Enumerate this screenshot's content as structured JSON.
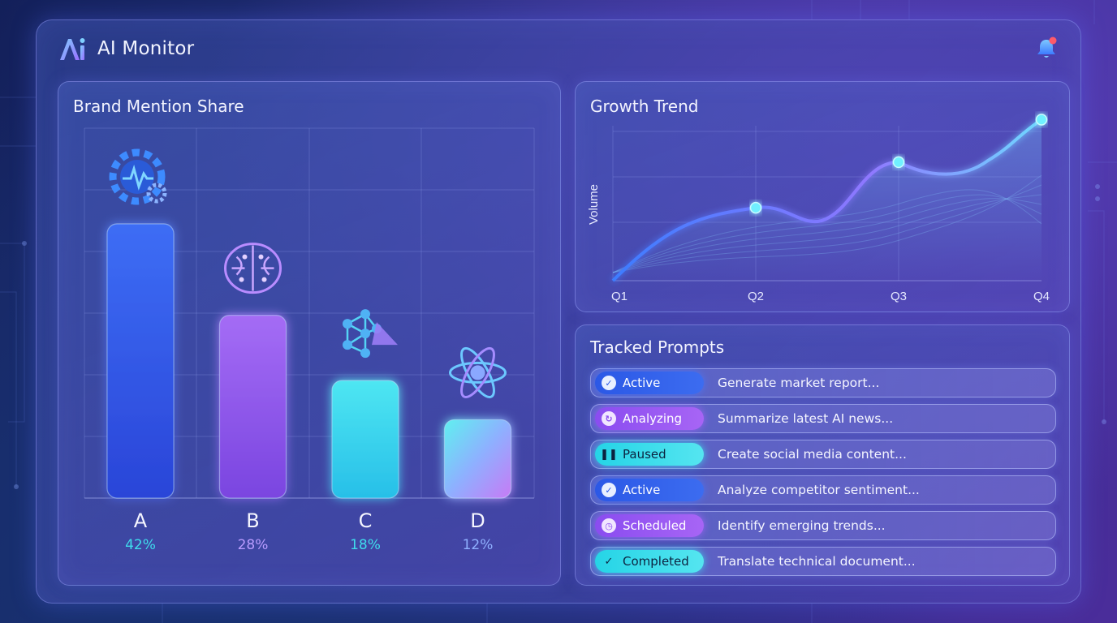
{
  "app": {
    "title": "AI Monitor",
    "logo_icon": "ai-logo-icon",
    "notification_icon": "bell-icon"
  },
  "colors": {
    "blue": "#3b6cf5",
    "purple": "#9a5cf2",
    "cyan": "#3fdcec",
    "gradient": "#8fb0ff",
    "accent_dot": "#ff5a6a"
  },
  "brand_share": {
    "title": "Brand Mention Share",
    "chart_data": {
      "type": "bar",
      "title": "Brand Mention Share",
      "categories": [
        "A",
        "B",
        "C",
        "D"
      ],
      "values": [
        42,
        28,
        18,
        12
      ],
      "value_labels": [
        "42%",
        "28%",
        "18%",
        "12%"
      ],
      "icons": [
        "gear-pulse-icon",
        "brain-circuit-icon",
        "network-prism-icon",
        "atom-icon"
      ],
      "ylim": [
        0,
        50
      ],
      "grid": true
    }
  },
  "growth": {
    "title": "Growth Trend",
    "chart_data": {
      "type": "line",
      "title": "Growth Trend",
      "categories": [
        "Q1",
        "Q2",
        "Q3",
        "Q4"
      ],
      "ylabel": "Volume",
      "values": [
        0,
        48,
        78,
        106
      ],
      "ylim": [
        0,
        110
      ],
      "grid": true
    }
  },
  "prompts": {
    "title": "Tracked Prompts",
    "items": [
      {
        "status": "Active",
        "style": "active",
        "icon": "check-circle-icon",
        "text": "Generate market report..."
      },
      {
        "status": "Analyzing",
        "style": "purple",
        "icon": "refresh-icon",
        "text": "Summarize latest AI news..."
      },
      {
        "status": "Paused",
        "style": "cyan",
        "icon": "pause-icon",
        "text": "Create social media content..."
      },
      {
        "status": "Active",
        "style": "active",
        "icon": "check-circle-icon",
        "text": "Analyze competitor sentiment..."
      },
      {
        "status": "Scheduled",
        "style": "purple",
        "icon": "clock-icon",
        "text": "Identify emerging trends..."
      },
      {
        "status": "Completed",
        "style": "cyan",
        "icon": "checkmark-icon",
        "text": "Translate technical document..."
      }
    ]
  }
}
